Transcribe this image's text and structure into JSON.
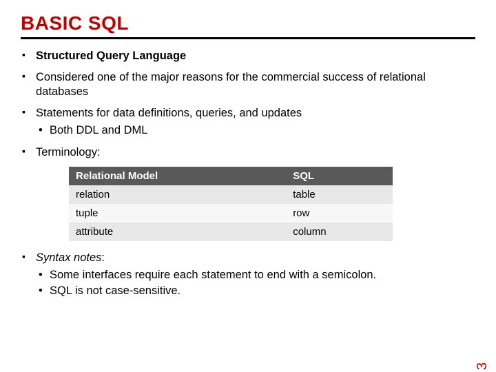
{
  "title": "BASIC SQL",
  "bullets": {
    "b1": "Structured Query Language",
    "b2": "Considered one of the major reasons for the commercial success of relational databases",
    "b3": "Statements for data definitions, queries, and updates",
    "b3_sub1": "Both DDL and DML",
    "b4": "Terminology:",
    "b5_lead": "Syntax notes",
    "b5_colon": ":",
    "b5_sub1": "Some interfaces require each statement to end with a semicolon.",
    "b5_sub2": "SQL is not case-sensitive."
  },
  "table": {
    "headers": {
      "c1": "Relational Model",
      "c2": "SQL"
    },
    "rows": [
      {
        "c1": "relation",
        "c2": "table"
      },
      {
        "c1": "tuple",
        "c2": "row"
      },
      {
        "c1": "attribute",
        "c2": "column"
      }
    ]
  },
  "page_number": "3"
}
